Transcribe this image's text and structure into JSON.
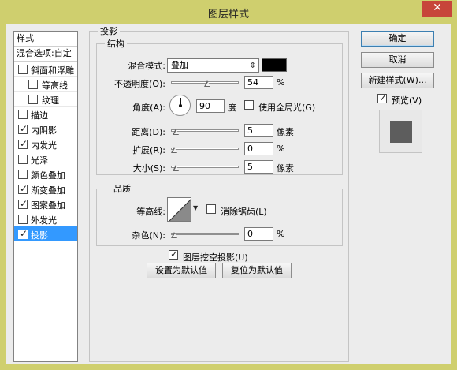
{
  "window": {
    "title": "图层样式",
    "close_glyph": "✕"
  },
  "style_list": {
    "header": "样式",
    "blending_options": "混合选项:自定",
    "items": [
      {
        "label": "斜面和浮雕",
        "checked": false,
        "indent": false
      },
      {
        "label": "等高线",
        "checked": false,
        "indent": true
      },
      {
        "label": "纹理",
        "checked": false,
        "indent": true
      },
      {
        "label": "描边",
        "checked": false,
        "indent": false
      },
      {
        "label": "内阴影",
        "checked": true,
        "indent": false
      },
      {
        "label": "内发光",
        "checked": true,
        "indent": false
      },
      {
        "label": "光泽",
        "checked": false,
        "indent": false
      },
      {
        "label": "颜色叠加",
        "checked": false,
        "indent": false
      },
      {
        "label": "渐变叠加",
        "checked": true,
        "indent": false
      },
      {
        "label": "图案叠加",
        "checked": true,
        "indent": false
      },
      {
        "label": "外发光",
        "checked": false,
        "indent": false
      },
      {
        "label": "投影",
        "checked": true,
        "indent": false,
        "selected": true
      }
    ]
  },
  "drop_shadow": {
    "section_title": "投影",
    "structure": {
      "title": "结构",
      "blend_mode_label": "混合模式:",
      "blend_mode_value": "叠加",
      "shadow_color": "#000000",
      "opacity_label": "不透明度(O):",
      "opacity_value": "54",
      "opacity_unit": "%",
      "opacity_level": 0.54,
      "angle_label": "角度(A):",
      "angle_value": "90",
      "angle_unit": "度",
      "global_light_label": "使用全局光(G)",
      "global_light_checked": false,
      "distance_label": "距离(D):",
      "distance_value": "5",
      "distance_unit": "像素",
      "distance_level": 0.02,
      "spread_label": "扩展(R):",
      "spread_value": "0",
      "spread_unit": "%",
      "spread_level": 0.0,
      "size_label": "大小(S):",
      "size_value": "5",
      "size_unit": "像素",
      "size_level": 0.02
    },
    "quality": {
      "title": "品质",
      "contour_label": "等高线:",
      "anti_alias_label": "消除锯齿(L)",
      "anti_alias_checked": false,
      "noise_label": "杂色(N):",
      "noise_value": "0",
      "noise_unit": "%",
      "noise_level": 0.0
    },
    "knockout_label": "图层挖空投影(U)",
    "knockout_checked": true,
    "make_default_label": "设置为默认值",
    "reset_default_label": "复位为默认值"
  },
  "buttons": {
    "ok": "确定",
    "cancel": "取消",
    "new_style": "新建样式(W)...",
    "preview_label": "预览(V)",
    "preview_checked": true
  },
  "colors": {
    "title_bar": "#cfcf6e",
    "close_button": "#c7453a",
    "selection": "#3399ff",
    "preview_square": "#5d5d5d"
  },
  "icons": {
    "close": "close-icon",
    "dropdown": "chevron-down-icon",
    "angle_dial": "angle-dial-icon",
    "contour": "contour-curve-icon"
  }
}
